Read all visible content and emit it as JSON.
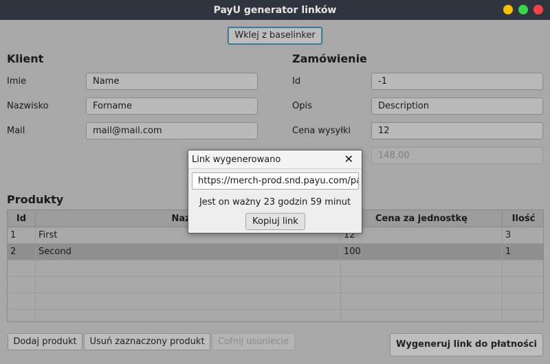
{
  "window": {
    "title": "PayU generator linków"
  },
  "toolbar": {
    "paste_label": "Wklej z baselinker"
  },
  "client": {
    "title": "Klient",
    "first_name_label": "Imie",
    "first_name_value": "Name",
    "last_name_label": "Nazwisko",
    "last_name_value": "Forname",
    "mail_label": "Mail",
    "mail_value": "mail@mail.com"
  },
  "order": {
    "title": "Zamówienie",
    "id_label": "Id",
    "id_value": "-1",
    "desc_label": "Opis",
    "desc_value": "Description",
    "shipping_label": "Cena wysyłki",
    "shipping_value": "12",
    "total_value": "148.00"
  },
  "products": {
    "title": "Produkty",
    "columns": [
      "Id",
      "Nazwa",
      "Cena za jednostkę",
      "Ilość"
    ],
    "rows": [
      {
        "id": "1",
        "name": "First",
        "price": "12",
        "qty": "3"
      },
      {
        "id": "2",
        "name": "Second",
        "price": "100",
        "qty": "1"
      }
    ]
  },
  "actions": {
    "add_label": "Dodaj produkt",
    "remove_label": "Usuń zaznaczony produkt",
    "undo_label": "Cofnij usuniecie",
    "generate_label": "Wygeneruj link do płatności"
  },
  "dialog": {
    "title": "Link wygenerowano",
    "close_glyph": "✕",
    "link_value": "https://merch-prod.snd.payu.com/pay",
    "message": "Jest on ważny 23 godzin 59 minut",
    "copy_label": "Kopiuj link"
  },
  "colors": {
    "titlebar": "#2f343f",
    "minimize": "#f6c000",
    "maximize": "#3cd34a",
    "close": "#f2444a"
  }
}
